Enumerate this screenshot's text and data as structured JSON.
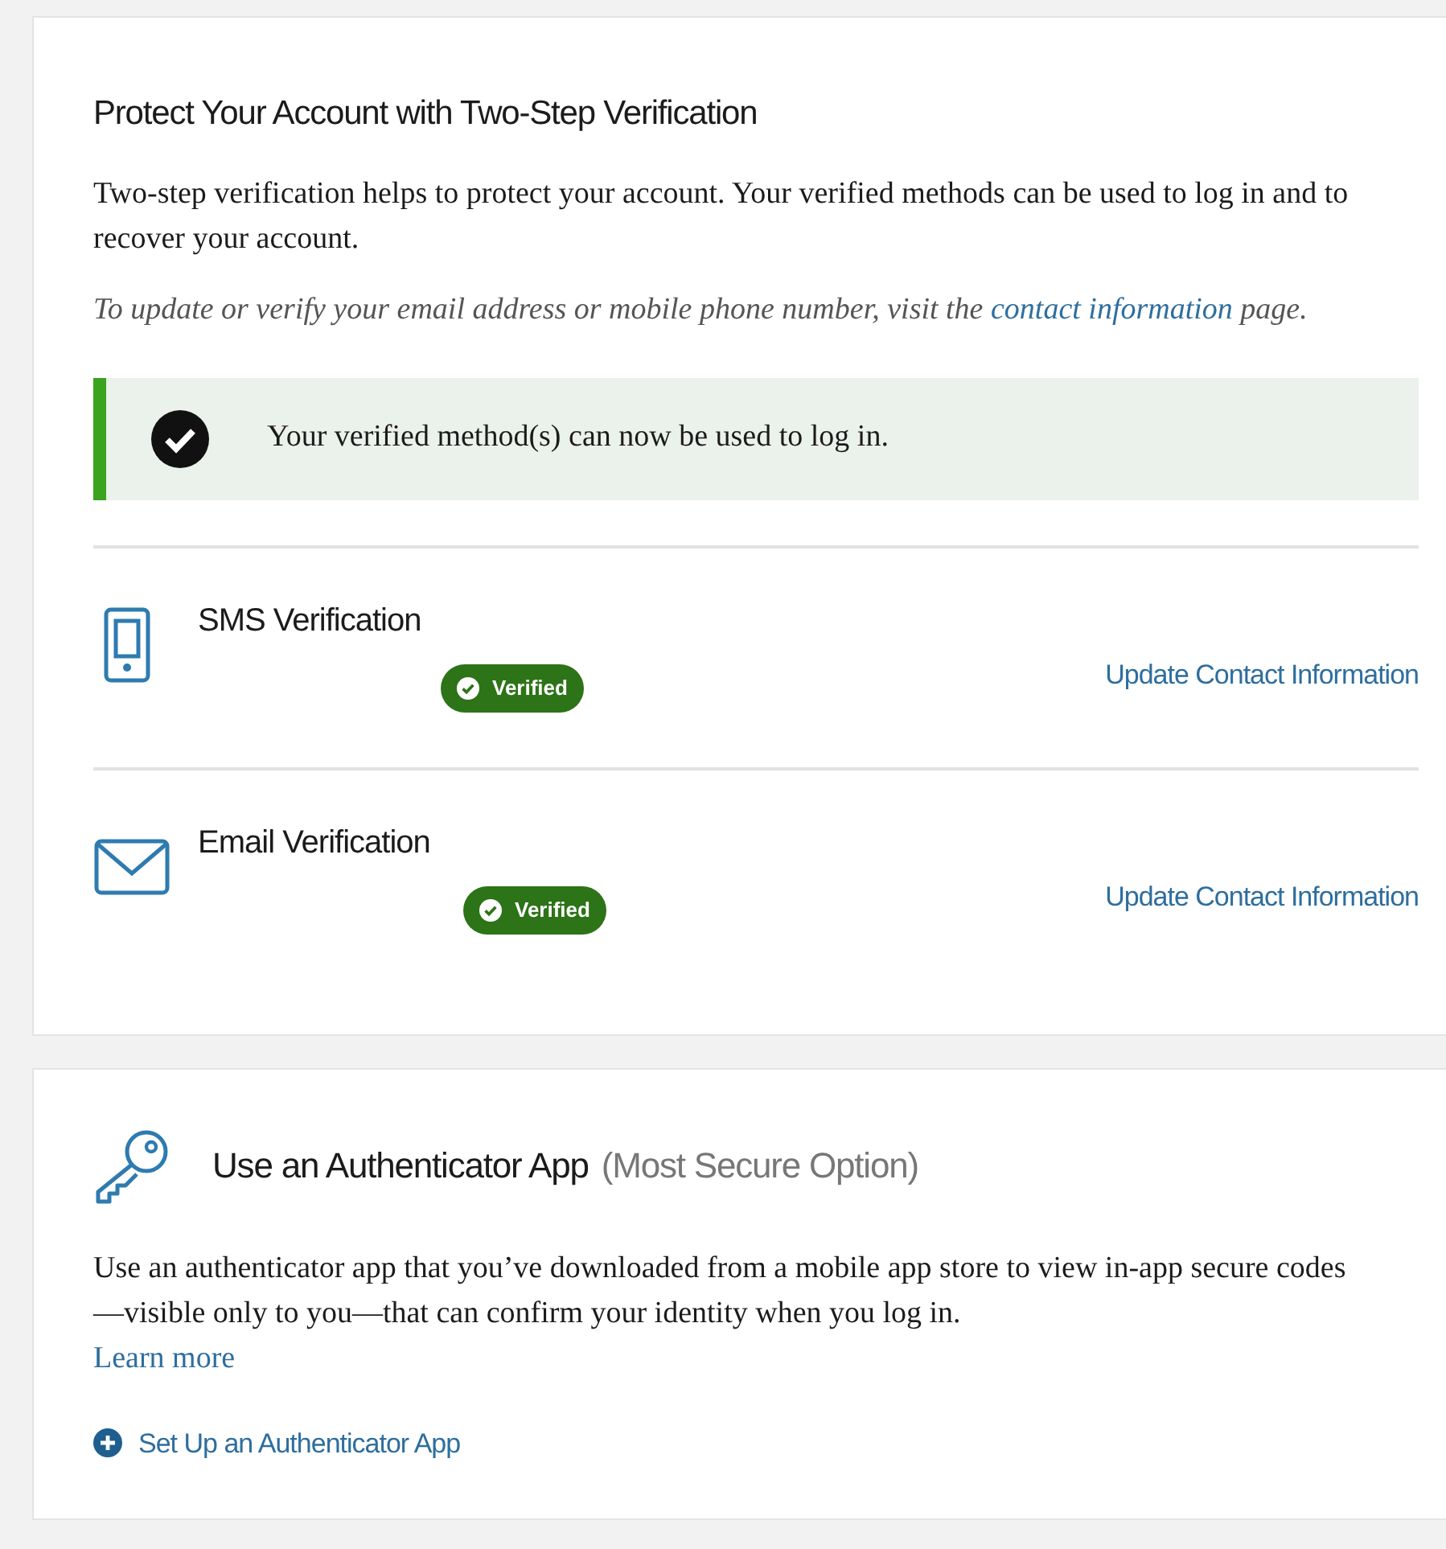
{
  "verification_card": {
    "title": "Protect Your Account with Two-Step Verification",
    "intro": "Two-step verification helps to protect your account. Your verified methods can be used to log in and to recover your account.",
    "note_before": "To update or verify your email address or mobile phone number, visit the",
    "note_link": "contact information",
    "note_after": "page.",
    "alert": {
      "kind": "success",
      "text": "Your verified method(s) can now be used to log in."
    },
    "methods": [
      {
        "kind": "phone",
        "name": "SMS Verification",
        "verified": true,
        "badge": "Verified",
        "action": "Update Contact Information"
      },
      {
        "kind": "email",
        "name": "Email Verification",
        "verified": true,
        "badge": "Verified",
        "action": "Update Contact Information"
      }
    ]
  },
  "authenticator_card": {
    "title": "Use an Authenticator App",
    "subtitle": "(Most Secure Option)",
    "description": "Use an authenticator app that you’ve downloaded from a mobile app store to view in-app secure codes—visible only to you—that can confirm your identity when you log in.",
    "learn_more": "Learn more",
    "setup_link": "Set Up an Authenticator App"
  }
}
